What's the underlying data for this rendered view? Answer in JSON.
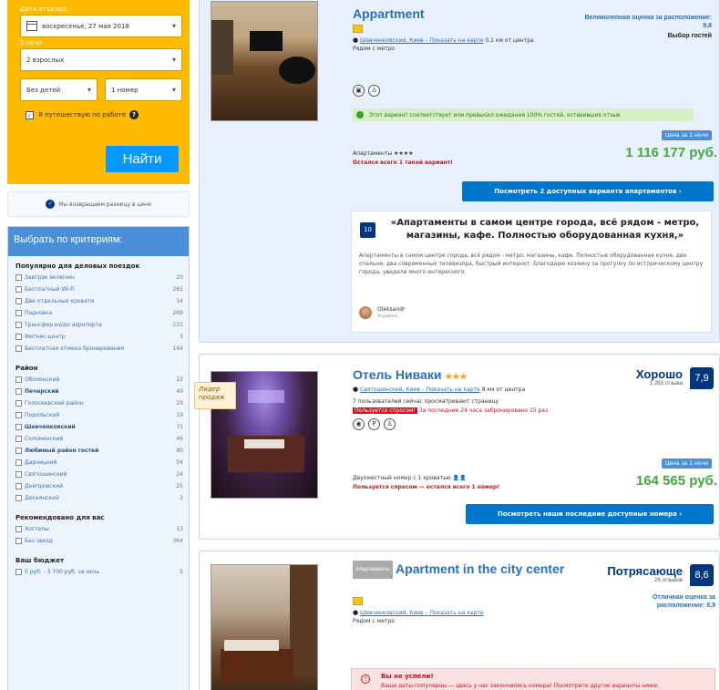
{
  "search": {
    "checkout_label": "Дата отъезда",
    "checkout_value": "воскресенье, 27 мая 2018",
    "nights_label": "2 ночи",
    "adults_value": "2 взрослых",
    "children_value": "Без детей",
    "rooms_value": "1 номер",
    "work_trip_label": "Я путешествую по работе",
    "search_button": "Найти"
  },
  "price_match": "Мы возвращаем разницу в цене",
  "filters": {
    "title": "Выбрать по критериям:",
    "groups": [
      {
        "heading": "Популярно для деловых поездок",
        "items": [
          {
            "label": "Завтрак включен",
            "count": "20"
          },
          {
            "label": "Бесплатный Wi-Fi",
            "count": "261"
          },
          {
            "label": "Две отдельные кровати",
            "count": "14"
          },
          {
            "label": "Парковка",
            "count": "269"
          },
          {
            "label": "Трансфер из/до аэропорта",
            "count": "231"
          },
          {
            "label": "Фитнес-центр",
            "count": "3"
          },
          {
            "label": "Бесплатная отмена бронирования",
            "count": "164"
          }
        ]
      },
      {
        "heading": "Район",
        "items": [
          {
            "label": "Оболонский",
            "count": "22"
          },
          {
            "label": "Печерский",
            "count": "49"
          },
          {
            "label": "Голосеевский район",
            "count": "29"
          },
          {
            "label": "Подольский",
            "count": "19"
          },
          {
            "label": "Шевченковский",
            "count": "71"
          },
          {
            "label": "Соломенский",
            "count": "46"
          },
          {
            "label": "Любимый район гостей",
            "count": "80"
          },
          {
            "label": "Дарницкий",
            "count": "54"
          },
          {
            "label": "Святошинский",
            "count": "24"
          },
          {
            "label": "Днепровский",
            "count": "25"
          },
          {
            "label": "Деснянский",
            "count": "3"
          }
        ]
      },
      {
        "heading": "Рекомендовано для вас",
        "items": [
          {
            "label": "Хостелы",
            "count": "13"
          },
          {
            "label": "Без звезд",
            "count": "364"
          }
        ]
      },
      {
        "heading": "Ваш бюджет",
        "items": [
          {
            "label": "0 руб. - 3 700 руб. за ночь",
            "count": "5"
          }
        ]
      }
    ]
  },
  "cards": [
    {
      "title": "Appartment",
      "address": "Шевченковский, Киев – Показать на карте",
      "distance": "0,1 км от центра",
      "nearby": "Рядом с метро",
      "score_text": "Великолепная оценка за расположение: 9,8",
      "choice": "Выбор гостей",
      "green_note": "Этот вариант соответствует или превысил ожидания 100% гостей, оставивших отзыв",
      "room": "Апартаменты ★★★★",
      "scarcity": "Остался всего 1 такой вариант!",
      "price_tag": "Цена за 2 ночи",
      "price": "1 116 177 руб.",
      "cta": "Посмотреть 2 доступных варианта апартаментов ›",
      "review_score": "10",
      "review_title": "«Апартаменты в самом центре города, всё рядом - метро, магазины, кафе. Полностью оборудованная кухня,»",
      "review_body": "Апартаменты в самом центре города, всё рядом - метро, магазины, кафе. Полностью оборудованная кухня, две спальни, два современных телевизора, быстрый интернет. Благодарю хозяину за прогулку по историческому центру города, увидели много интересного.",
      "review_author": "Oleksandr",
      "review_country": "Украина"
    },
    {
      "title": "Отель Ниваки",
      "stars": "★★★",
      "ribbon": "Лидер продаж",
      "address": "Святошинский, Киев – Показать на карте",
      "distance": "8 км от центра",
      "viewing": "7 пользователей сейчас просматривают страницу",
      "popular_badge": "Пользуется спросом!",
      "booked": "За последние 24 часа забронировано 15 раз",
      "score_word": "Хорошо",
      "reviews_count": "1 283 отзыва",
      "score": "7,9",
      "room": "Двухместный номер с 1 кроватью 👤👤",
      "scarcity": "Пользуется спросом — остался всего 1 номер!",
      "price_tag": "Цена за 2 ночи",
      "price": "164 565 руб.",
      "cta": "Посмотреть наши последние доступные номера ›"
    },
    {
      "badge": "Апартаменты",
      "title": "Apartment in the city center",
      "address": "Шевченковский, Киев – Показать на карте",
      "nearby": "Рядом с метро",
      "score_word": "Потрясающе",
      "reviews_count": "26 отзывов",
      "score": "8,6",
      "location_note": "Отличная оценка за расположение: 8,9",
      "alert_title": "Вы не успели!",
      "alert_body": "Ваши даты популярны — здесь у нас закончились номера! Посмотрите другие варианты ниже."
    }
  ],
  "colors": {
    "search_bg": "#febb02",
    "primary_blue": "#0077cc",
    "score_blue": "#003580",
    "price_green": "#43a83d",
    "alert_red": "#d4111e"
  }
}
